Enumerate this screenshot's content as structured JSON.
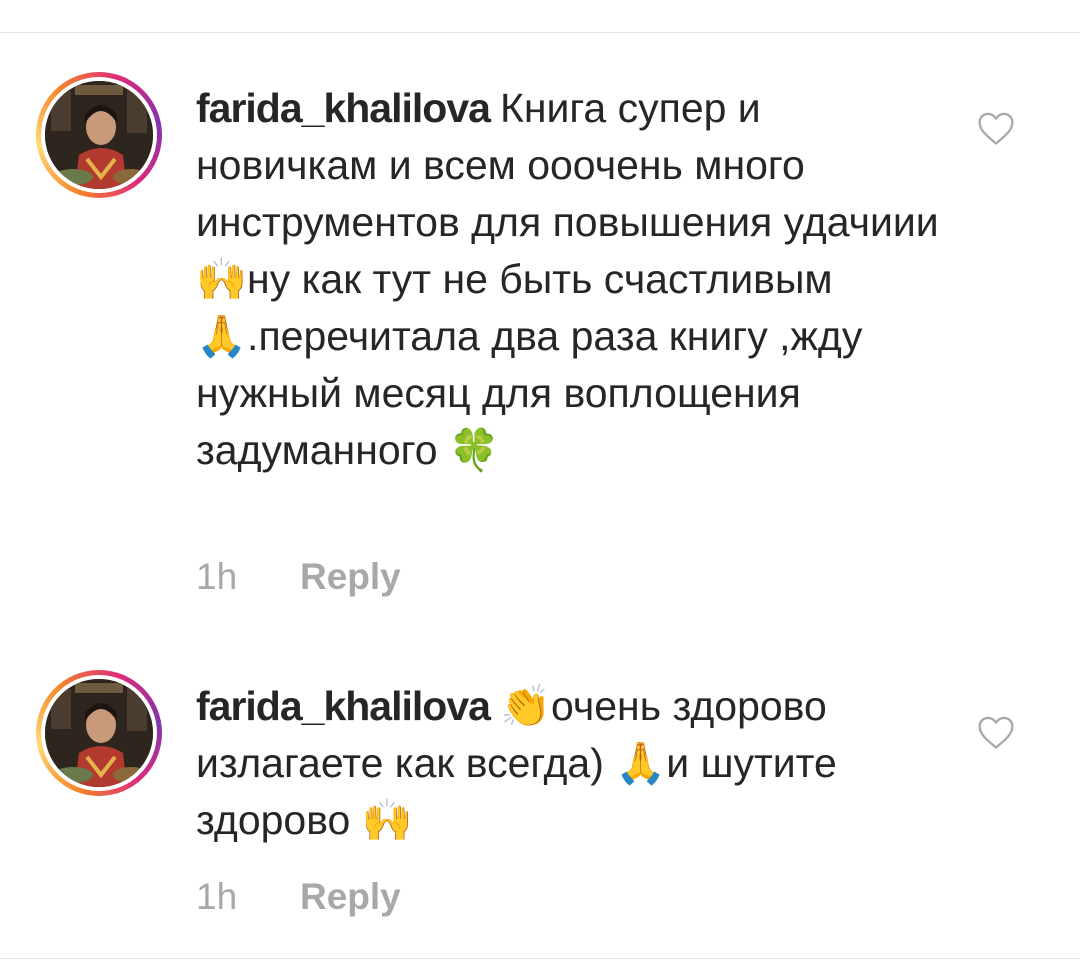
{
  "comments": [
    {
      "username": "farida_khalilova",
      "text": "Книга супер и новичкам и всем ооочень много инструментов для повышения удачиии🙌ну как тут не быть счастливым🙏.перечитала два раза книгу ,жду нужный месяц для воплощения задуманного 🍀",
      "time": "1h",
      "reply_label": "Reply",
      "avatar_icon": "profile-photo",
      "like_icon": "heart-outline-icon"
    },
    {
      "username": "farida_khalilova",
      "text": "👏очень здорово излагаете как всегда) 🙏и шутите здорово 🙌",
      "time": "1h",
      "reply_label": "Reply",
      "avatar_icon": "profile-photo",
      "like_icon": "heart-outline-icon"
    }
  ],
  "colors": {
    "text": "#262626",
    "meta": "#a8a8a8",
    "ring_start": "#f58529",
    "ring_end": "#dd2a7b",
    "divider": "#e6e6e6"
  }
}
